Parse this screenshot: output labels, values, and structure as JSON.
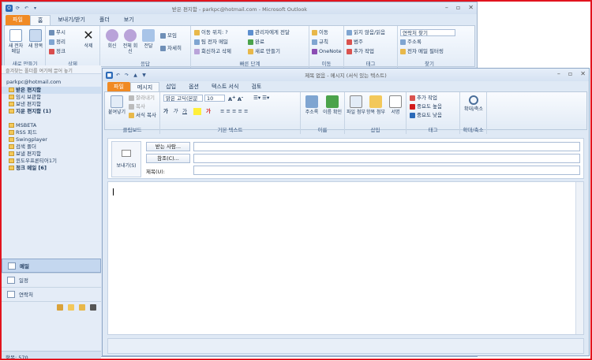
{
  "outlook": {
    "title": "받은 편지함 - parkpc@hotmail.com - Microsoft Outlook",
    "tabs": [
      "파일",
      "홈",
      "보내기/받기",
      "폴더",
      "보기"
    ],
    "groups": {
      "new": {
        "label": "새로 만들기",
        "new_email": "새 전자 메일",
        "new_items": "새 항목"
      },
      "delete": {
        "label": "삭제",
        "ignore": "무시",
        "cleanup": "정리",
        "junk": "정크",
        "delete": "삭제"
      },
      "respond": {
        "label": "응답",
        "reply": "회신",
        "reply_all": "전체 회신",
        "forward": "전달",
        "meeting": "모임",
        "more": "자세히"
      },
      "quick": {
        "label": "빠른 단계",
        "items": [
          "이동 위치: ?",
          "팀 전자 메일",
          "회신하고 삭제",
          "관리자에게 전달",
          "완료",
          "새로 만들기"
        ]
      },
      "move": {
        "label": "이동",
        "move": "이동",
        "rules": "규칙",
        "onenote": "OneNote"
      },
      "tags": {
        "label": "태그",
        "unread": "읽지 않음/읽음",
        "categorize": "범주",
        "followup": "추가 작업"
      },
      "find": {
        "label": "찾기",
        "search_contacts": "연락처 찾기",
        "address_book": "주소록",
        "filter": "전자 메일 필터링"
      }
    },
    "nav": {
      "search_hint": "즐겨찾는 폴더를 여기에 끌어 놓기",
      "account": "parkpc@hotmail.com",
      "folders": [
        {
          "label": "받은 편지함"
        },
        {
          "label": "임시 보관함"
        },
        {
          "label": "보낸 편지함"
        },
        {
          "label": "지운 편지함 (1)"
        },
        {
          "label": ""
        },
        {
          "label": "MSBETA"
        },
        {
          "label": "RSS 피드"
        },
        {
          "label": "Swingplayer"
        },
        {
          "label": "검색 폴더"
        },
        {
          "label": "보낼 편지함"
        },
        {
          "label": "윈도우프론티어1기"
        },
        {
          "label": "정크 메일 [6]"
        }
      ],
      "mail": "메일",
      "calendar": "일정",
      "contacts": "연락처",
      "status": "항목: 570"
    }
  },
  "message": {
    "title": "제목 없음 - 메시지 (서식 있는 텍스트)",
    "tabs": [
      "파일",
      "메시지",
      "삽입",
      "옵션",
      "텍스트 서식",
      "검토"
    ],
    "groups": {
      "clipboard": {
        "label": "클립보드",
        "paste": "붙여넣기",
        "cut": "잘라내기",
        "copy": "복사",
        "format": "서식 복사"
      },
      "text": {
        "label": "기본 텍스트",
        "font": "맑은 고딕(본문",
        "size": "10"
      },
      "names": {
        "label": "이름",
        "address": "주소록",
        "check": "이름 확인"
      },
      "insert": {
        "label": "삽입",
        "attach": "파일 첨부",
        "item": "항목 첨부",
        "signature": "서명"
      },
      "tags": {
        "label": "태그",
        "followup": "추가 작업",
        "high": "중요도 높음",
        "low": "중요도 낮음"
      },
      "zoom": {
        "label": "확대/축소",
        "zoom": "확대/축소"
      }
    },
    "send": "보내기(S)",
    "to": "받는 사람...",
    "cc": "참조(C)...",
    "subject": "제목(U):"
  }
}
